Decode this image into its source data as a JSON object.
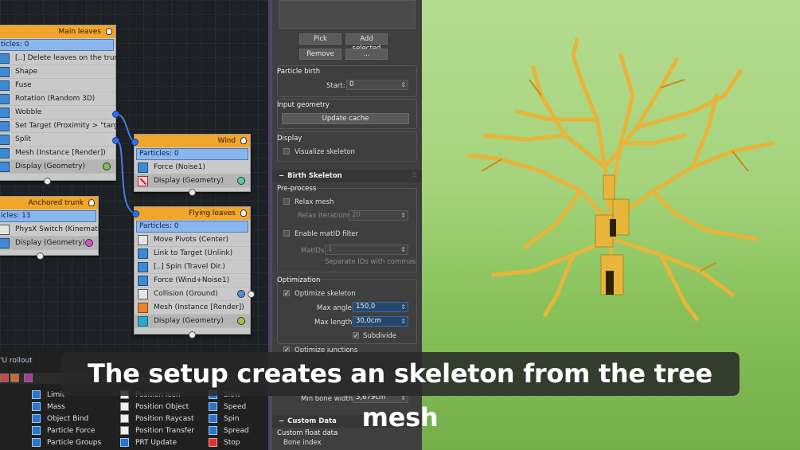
{
  "node_editor": {
    "main_leaves": {
      "title": "Main leaves",
      "particles": "ticles: 0",
      "operators": [
        {
          "label": "[..] Delete leaves on the trunk (On...",
          "icon": "delete-icon"
        },
        {
          "label": "Shape",
          "icon": "shape-icon"
        },
        {
          "label": "Fuse",
          "icon": "fuse-icon"
        },
        {
          "label": "Rotation (Random 3D)",
          "icon": "rotation-icon"
        },
        {
          "label": "Wobble",
          "icon": "wobble-icon"
        },
        {
          "label": "Set Target (Proximity > \"target\")",
          "icon": "set-target-icon"
        },
        {
          "label": "Split",
          "icon": "split-icon"
        },
        {
          "label": "Mesh (Instance [Render])",
          "icon": "mesh-icon"
        },
        {
          "label": "Display (Geometry)",
          "icon": "display-icon",
          "dot_color": "#7cc24b"
        }
      ]
    },
    "wind": {
      "title": "Wind",
      "particles": "Particles: 0",
      "operators": [
        {
          "label": "Force (Noise1)",
          "icon": "force-icon"
        },
        {
          "label": "Display (Geometry)",
          "icon": "display-disabled-icon",
          "dot_color": "#4fd1a5"
        }
      ]
    },
    "anchored_trunk": {
      "title": "Anchored trunk",
      "particles": "icles: 13",
      "operators": [
        {
          "label": "PhysX Switch (Kinematic)",
          "icon": "physx-switch-icon"
        },
        {
          "label": "Display (Geometry)",
          "icon": "display-icon",
          "dot_color": "#d653c7"
        }
      ]
    },
    "flying_leaves": {
      "title": "Flying leaves",
      "particles": "Particles: 0",
      "operators": [
        {
          "label": "Move Pivots (Center)",
          "icon": "move-pivots-icon"
        },
        {
          "label": "Link to Target (Unlink)",
          "icon": "link-target-icon"
        },
        {
          "label": "[..] Spin (Travel Dir.)",
          "icon": "spin-icon"
        },
        {
          "label": "Force (Wind+Noise1)",
          "icon": "force-icon"
        },
        {
          "label": "Collision (Ground)",
          "icon": "collision-icon",
          "dot_color": "#4d8fd6"
        },
        {
          "label": "Mesh (Instance [Render])",
          "icon": "mesh-icon"
        },
        {
          "label": "Display (Geometry)",
          "icon": "display-icon",
          "dot_color": "#a8c43a"
        }
      ]
    },
    "rollout_label": "'U rollout"
  },
  "depot": {
    "columns": [
      [
        {
          "label": "Limit",
          "icon": "limit-icon"
        },
        {
          "label": "Mass",
          "icon": "mass-icon"
        },
        {
          "label": "Object Bind",
          "icon": "object-bind-icon"
        },
        {
          "label": "Particle Force",
          "icon": "particle-force-icon"
        },
        {
          "label": "Particle Groups",
          "icon": "particle-groups-icon"
        }
      ],
      [
        {
          "label": "Position Icon",
          "icon": "position-icon-icon"
        },
        {
          "label": "Position Object",
          "icon": "position-object-icon"
        },
        {
          "label": "Position Raycast",
          "icon": "position-raycast-icon"
        },
        {
          "label": "Position Transfer",
          "icon": "position-transfer-icon"
        },
        {
          "label": "PRT Update",
          "icon": "prt-update-icon"
        }
      ],
      [
        {
          "label": "Slow",
          "icon": "slow-icon"
        },
        {
          "label": "Speed",
          "icon": "speed-icon"
        },
        {
          "label": "Spin",
          "icon": "spin-icon"
        },
        {
          "label": "Spread",
          "icon": "spread-icon"
        },
        {
          "label": "Stop",
          "icon": "stop-icon"
        }
      ]
    ]
  },
  "properties": {
    "pick_label": "Pick",
    "add_selected_label": "Add selected",
    "remove_label": "Remove",
    "more_label": "...",
    "particle_birth": {
      "heading": "Particle birth",
      "start_label": "Start:",
      "start_value": "0"
    },
    "input_geometry": {
      "heading": "Input geometry",
      "update_cache_label": "Update cache"
    },
    "display": {
      "heading": "Display",
      "visualize_skeleton": "Visualize skeleton",
      "visualize_checked": false
    },
    "birth_skeleton": {
      "title": "Birth Skeleton",
      "preprocess": "Pre-process",
      "relax_mesh": "Relax mesh",
      "relax_iterations_label": "Relax iterations:",
      "relax_iterations_value": "20",
      "enable_matid": "Enable matID filter",
      "matids_label": "MatIDs:",
      "matids_value": "1",
      "separate_note": "Separate IDs with commas",
      "optimization": "Optimization",
      "optimize_skeleton": "Optimize skeleton",
      "optimize_checked": true,
      "max_angle_label": "Max angle:",
      "max_angle_value": "150,0",
      "max_length_label": "Max length:",
      "max_length_value": "30,0cm",
      "subdivide": "Subdivide",
      "subdivide_checked": true,
      "optimize_junctions": "Optimize junctions",
      "min_bone_width_label": "Min bone width:",
      "min_bone_width_value": "5,679cm"
    },
    "custom_data": {
      "title": "Custom Data",
      "custom_float": "Custom float data",
      "bone_index": "Bone index"
    }
  },
  "subtitle": "The setup creates an skeleton from the tree mesh",
  "colors": {
    "node_header": "#f1a52b",
    "particles_bar": "#8ab6ee",
    "wire": "#3d7fe6",
    "viewport_bg": "#a5d47d",
    "tree": "#e8b43a"
  }
}
